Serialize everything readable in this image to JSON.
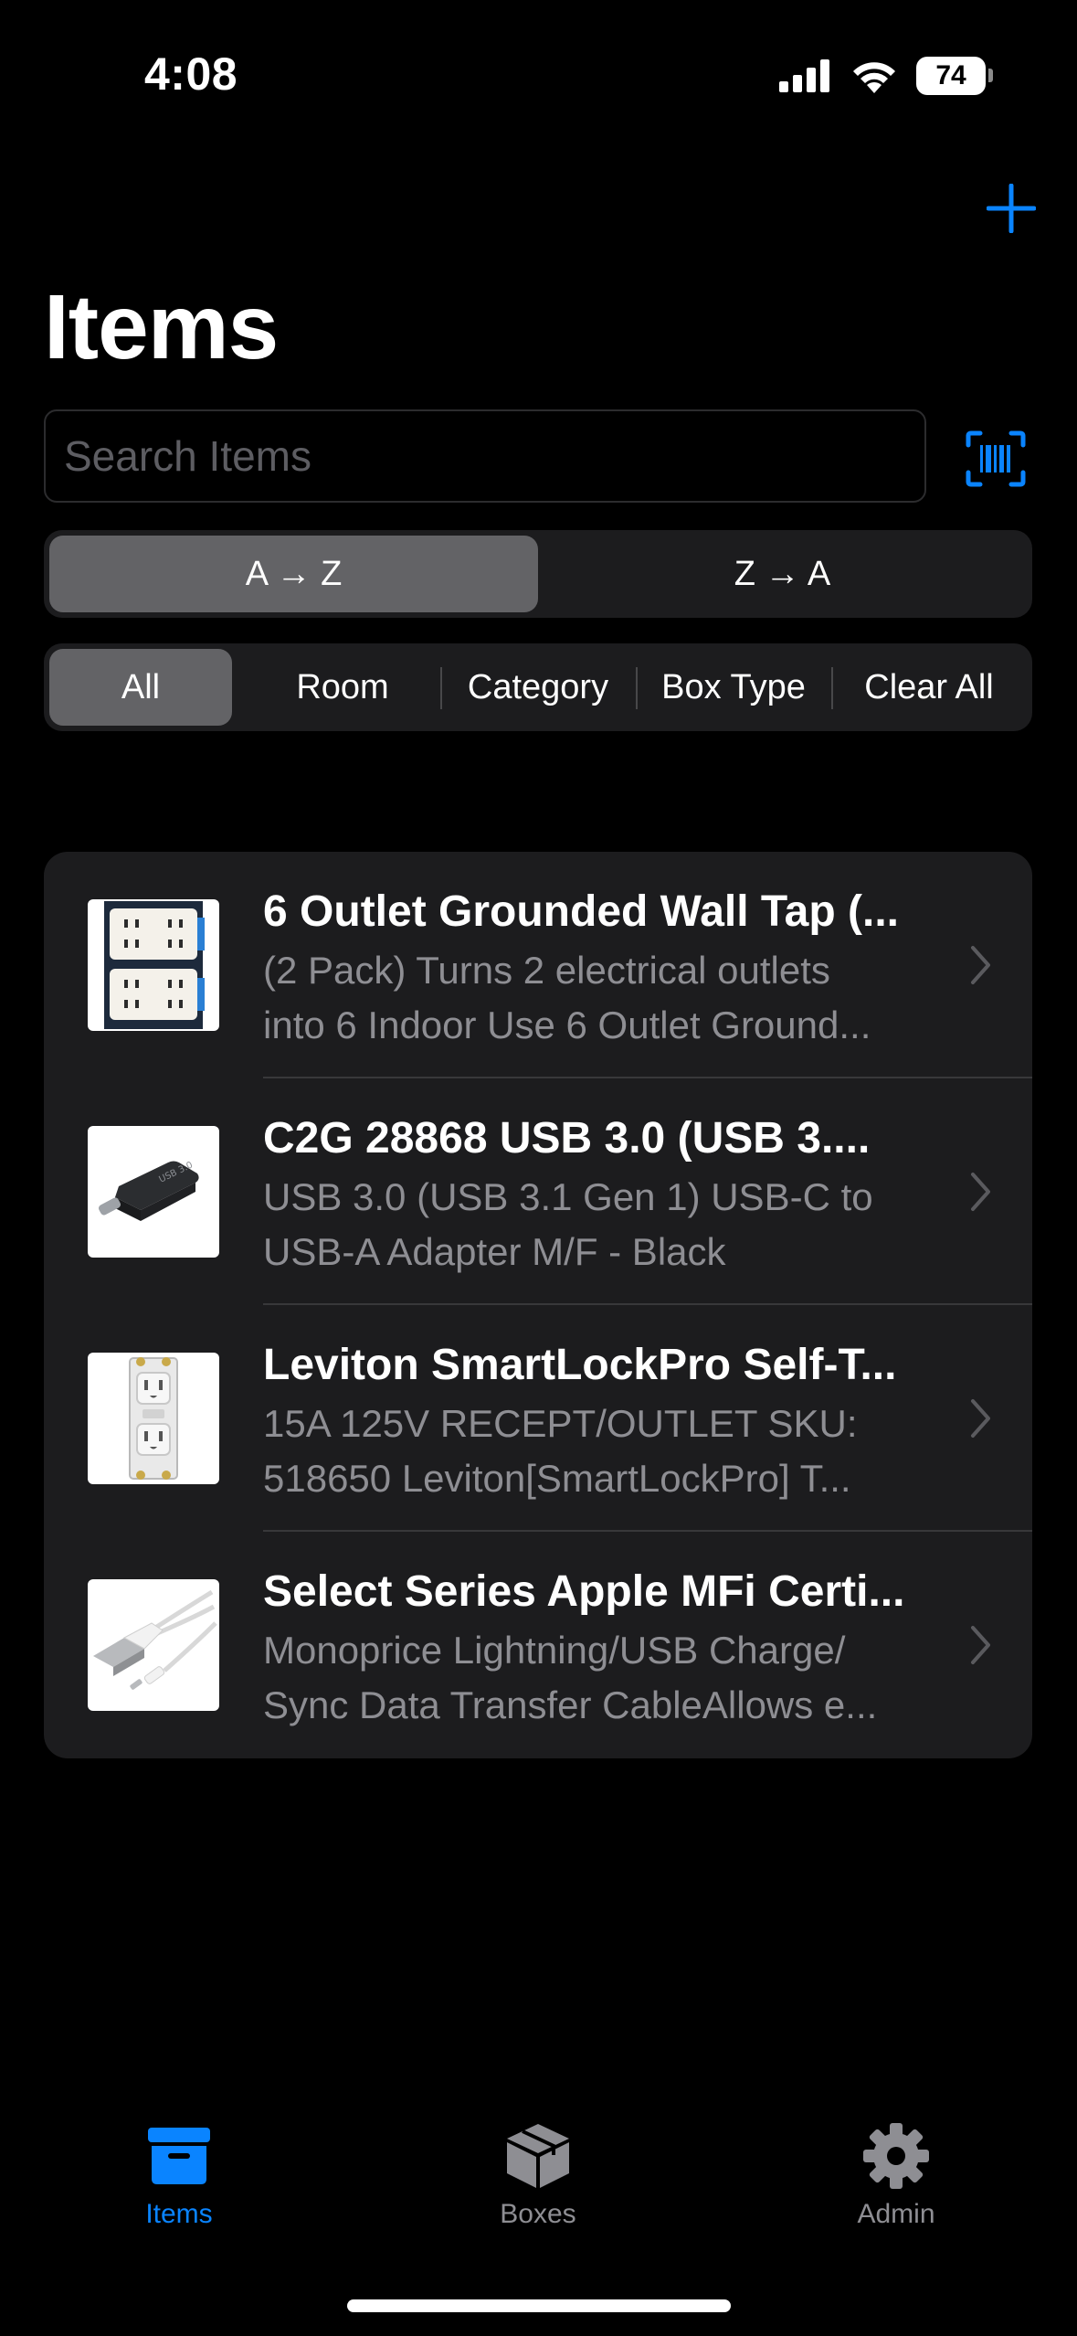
{
  "status_bar": {
    "time": "4:08",
    "battery": "74"
  },
  "nav": {
    "title": "Items",
    "add_icon": "plus-icon"
  },
  "search": {
    "placeholder": "Search Items",
    "scan_icon": "barcode-scan-icon"
  },
  "sort": {
    "options": [
      "A → Z",
      "Z → A"
    ],
    "selected": "A → Z"
  },
  "filters": {
    "options": [
      "All",
      "Room",
      "Category",
      "Box Type",
      "Clear All"
    ],
    "selected": "All"
  },
  "items": [
    {
      "title": "6 Outlet Grounded Wall Tap (...",
      "desc_line1": "(2 Pack) Turns 2 electrical outlets",
      "desc_line2": "into 6 Indoor Use 6 Outlet Ground...",
      "thumb_icon": "wall-tap-thumbnail"
    },
    {
      "title": "C2G 28868 USB 3.0 (USB 3....",
      "desc_line1": "USB 3.0 (USB 3.1 Gen 1) USB-C to",
      "desc_line2": "USB-A Adapter M/F - Black",
      "thumb_icon": "usb-adapter-thumbnail"
    },
    {
      "title": "Leviton SmartLockPro Self-T...",
      "desc_line1": "15A 125V RECEPT/OUTLET SKU:",
      "desc_line2": "518650 Leviton[SmartLockPro] T...",
      "thumb_icon": "outlet-thumbnail"
    },
    {
      "title": "Select Series Apple MFi Certi...",
      "desc_line1": "Monoprice Lightning/USB Charge/",
      "desc_line2": "Sync Data Transfer CableAllows e...",
      "thumb_icon": "lightning-cable-thumbnail"
    }
  ],
  "tab_bar": {
    "tabs": [
      {
        "label": "Items",
        "icon": "archive-box-icon",
        "active": true
      },
      {
        "label": "Boxes",
        "icon": "cube-box-icon",
        "active": false
      },
      {
        "label": "Admin",
        "icon": "gear-icon",
        "active": false
      }
    ]
  },
  "colors": {
    "accent": "#0a84ff",
    "background": "#000000",
    "card": "#1c1c1e",
    "secondary_text": "#8e8e93",
    "inactive_tab": "#8e8e93"
  }
}
